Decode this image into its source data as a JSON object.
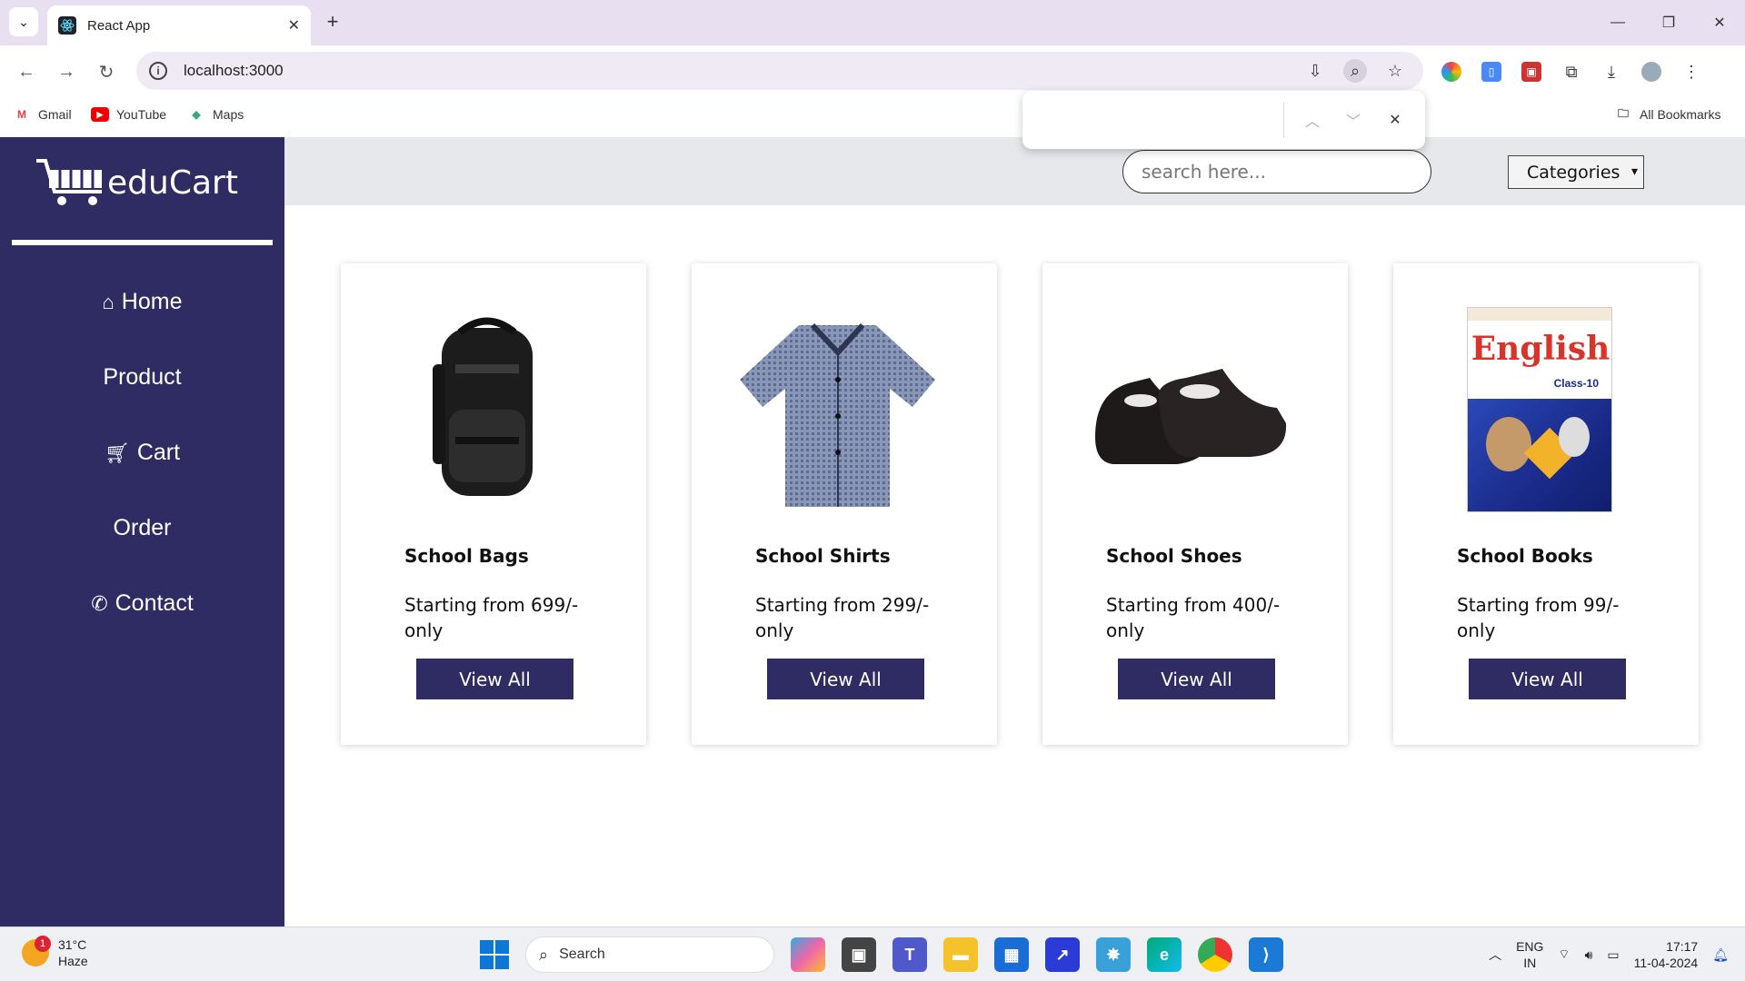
{
  "browser": {
    "tab_title": "React App",
    "url": "localhost:3000",
    "bookmarks": [
      {
        "label": "Gmail"
      },
      {
        "label": "YouTube"
      },
      {
        "label": "Maps"
      }
    ],
    "all_bookmarks": "All Bookmarks"
  },
  "app": {
    "logo_text": "eduCart",
    "nav": [
      {
        "label": "Home",
        "icon": "home-icon"
      },
      {
        "label": "Product",
        "icon": ""
      },
      {
        "label": "Cart",
        "icon": "cart-icon"
      },
      {
        "label": "Order",
        "icon": ""
      },
      {
        "label": "Contact",
        "icon": "phone-icon"
      }
    ],
    "search_placeholder": "search here...",
    "categories_label": "Categories",
    "products": [
      {
        "name": "School Bags",
        "price": "Starting from 699/- only",
        "button": "View All"
      },
      {
        "name": "School Shirts",
        "price": "Starting from 299/- only",
        "button": "View All"
      },
      {
        "name": "School Shoes",
        "price": "Starting from 400/- only",
        "button": "View All"
      },
      {
        "name": "School Books",
        "price": "Starting from 99/- only",
        "button": "View All",
        "book_title": "English",
        "book_subtitle": "Class-10"
      }
    ]
  },
  "taskbar": {
    "weather_temp": "31°C",
    "weather_desc": "Haze",
    "weather_badge": "1",
    "search_label": "Search",
    "lang_top": "ENG",
    "lang_bottom": "IN",
    "time": "17:17",
    "date": "11-04-2024"
  },
  "colors": {
    "sidebar": "#2e2c63",
    "button": "#2e2c63",
    "topbar": "#e6e8ec",
    "tabbar": "#e8dff1"
  }
}
